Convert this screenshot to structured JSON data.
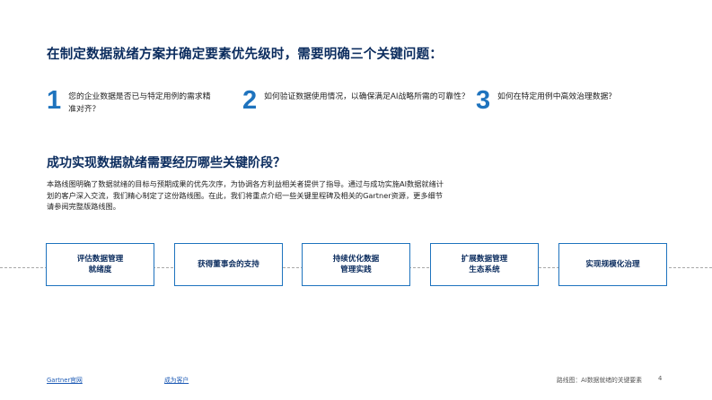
{
  "headline": "在制定数据就绪方案并确定要素优先级时，需要明确三个关键问题：",
  "questions": [
    {
      "number": "1",
      "text": "您的企业数据是否已与特定用例的需求精准对齐？"
    },
    {
      "number": "2",
      "text": "如何验证数据使用情况，以确保满足AI战略所需的可靠性？"
    },
    {
      "number": "3",
      "text": "如何在特定用例中高效治理数据？"
    }
  ],
  "subhead": "成功实现数据就绪需要经历哪些关键阶段？",
  "body": "本路线图明确了数据就绪的目标与预期成果的优先次序，为协调各方利益相关者提供了指导。通过与成功实施AI数据就绪计划的客户深入交流，我们精心制定了这份路线图。在此，我们将重点介绍一些关键里程碑及相关的Gartner资源，更多细节请参阅完整版路线图。",
  "stages": [
    {
      "line1": "评估数据管理",
      "line2": "就绪度"
    },
    {
      "line1": "获得董事会的支持",
      "line2": ""
    },
    {
      "line1": "持续优化数据",
      "line2": "管理实践"
    },
    {
      "line1": "扩展数据管理",
      "line2": "生态系统"
    },
    {
      "line1": "实现规模化治理",
      "line2": ""
    }
  ],
  "footer": {
    "brand": "Gartner官网",
    "client_link": "成为客户",
    "doc_title": "路线图：AI数据就绪的关键要素",
    "page_number": "4"
  },
  "colors": {
    "navy": "#0b2c5e",
    "accent_blue": "#1e73be",
    "link_blue": "#1e5bb5"
  }
}
